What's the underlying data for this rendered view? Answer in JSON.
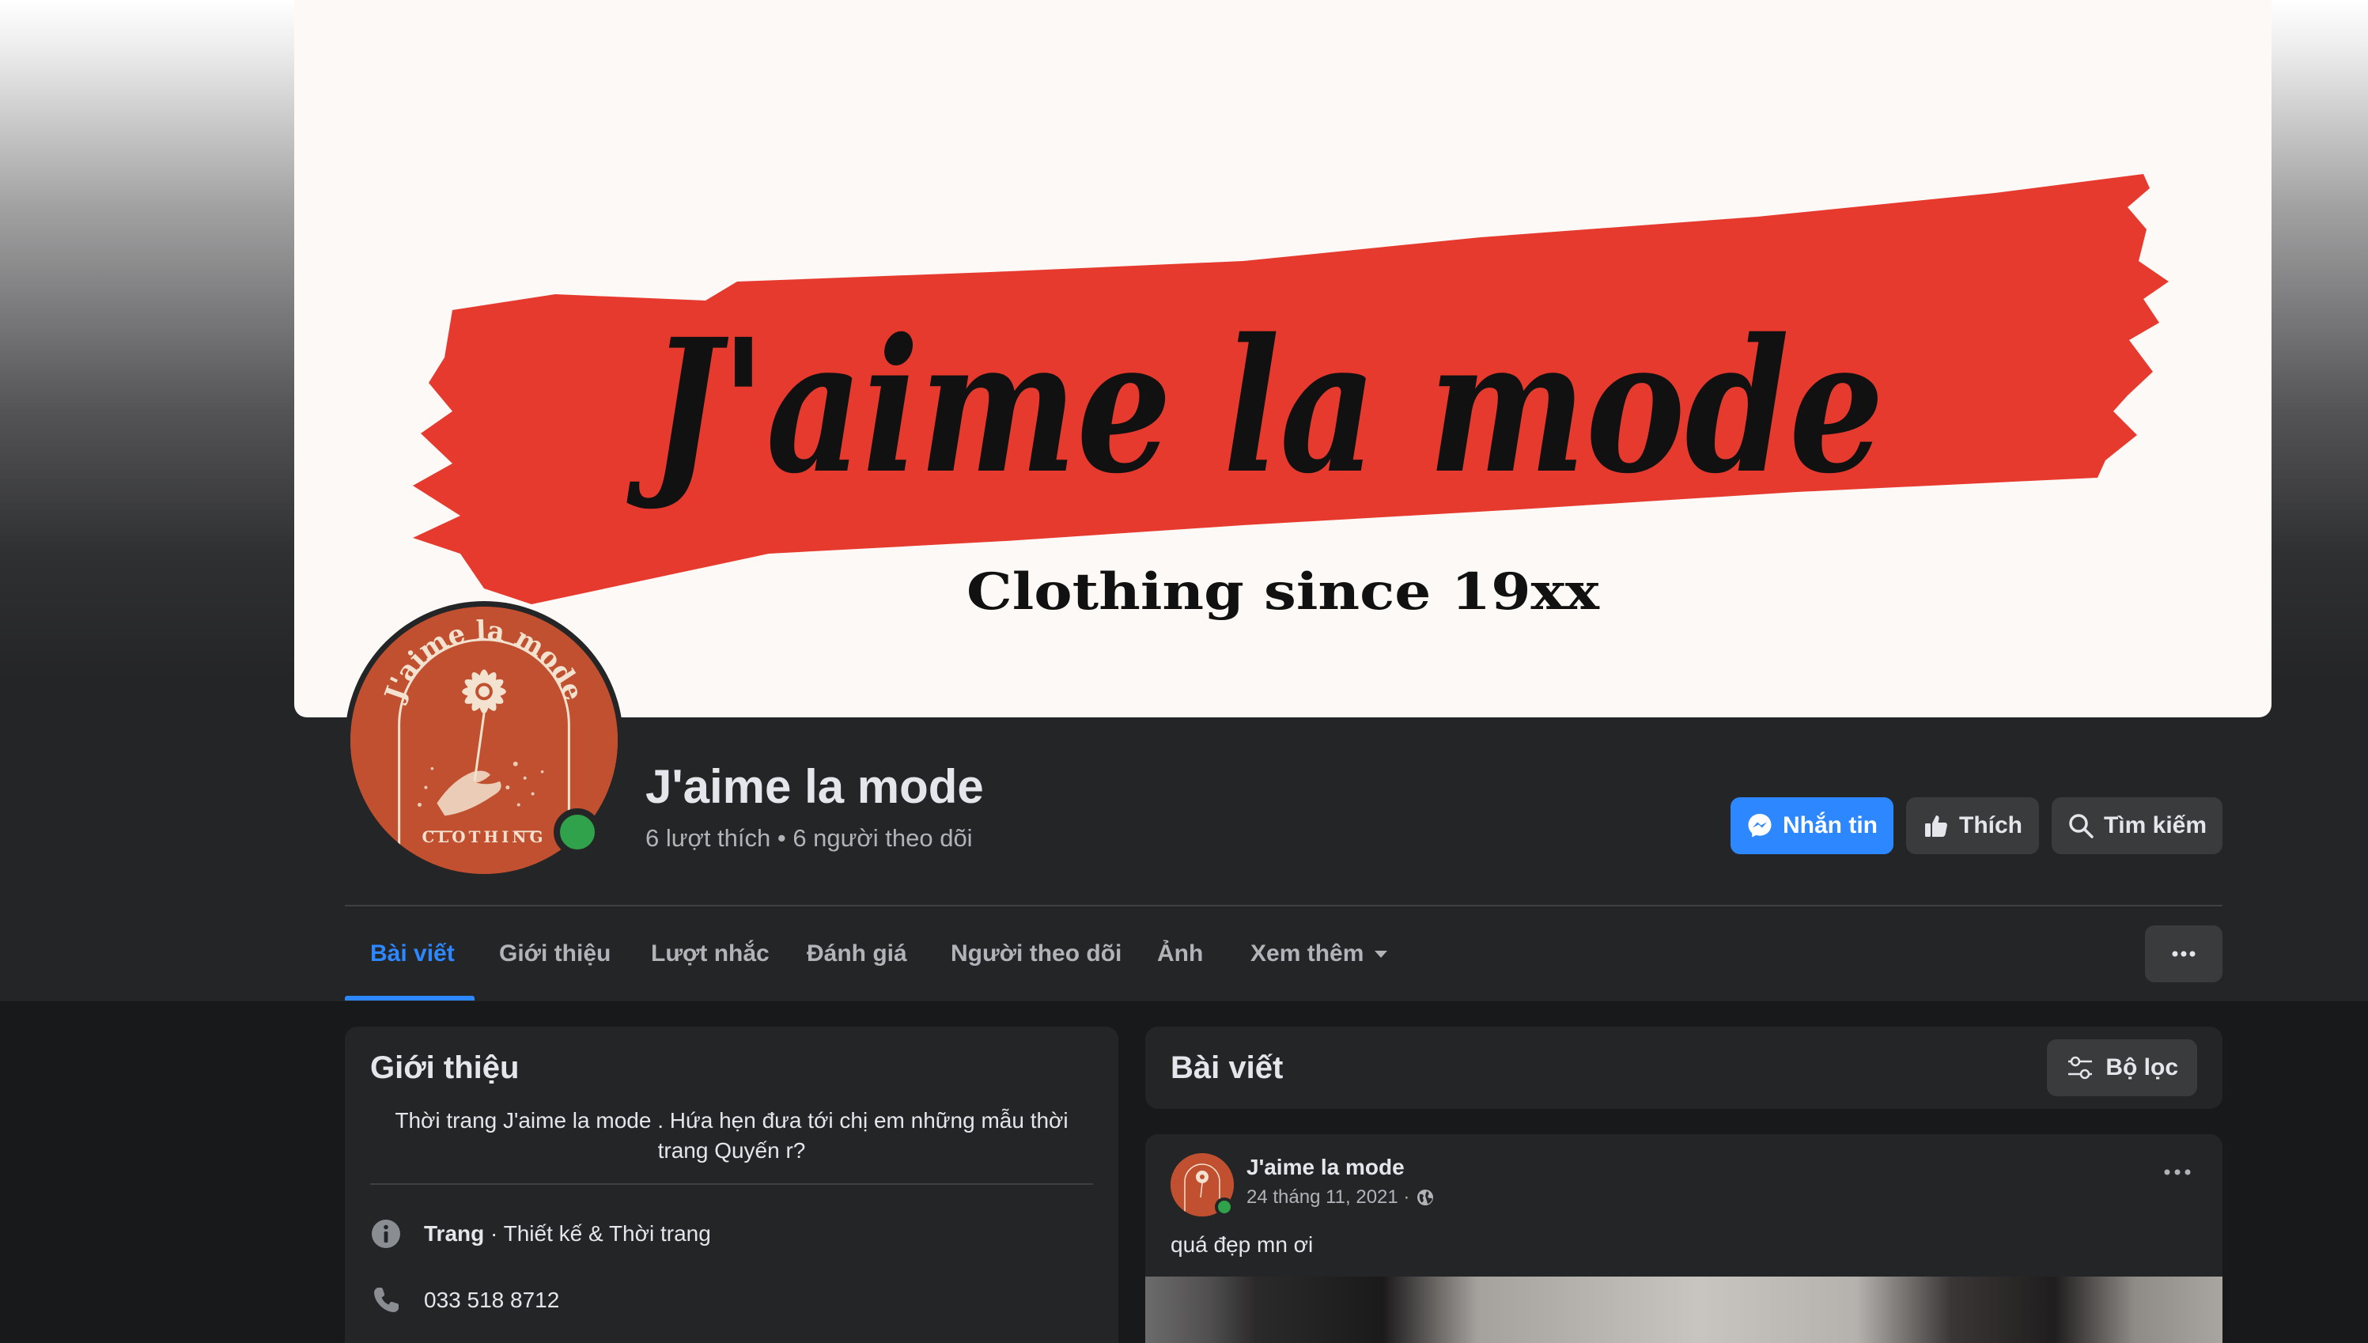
{
  "cover": {
    "brand_script": "J'aime la mode",
    "tagline": "Clothing since 19xx",
    "colors": {
      "background": "#fdf9f6",
      "brush": "#e63a2e",
      "ink": "#111111"
    }
  },
  "avatar": {
    "logo_text_top": "J'aime la mode",
    "logo_text_bottom": "CLOTHING",
    "color": "#c0502f"
  },
  "page": {
    "name": "J'aime la mode",
    "stats": "6 lượt thích • 6 người theo dõi"
  },
  "actions": {
    "message": "Nhắn tin",
    "like": "Thích",
    "search": "Tìm kiếm"
  },
  "tabs": [
    {
      "label": "Bài viết",
      "active": true
    },
    {
      "label": "Giới thiệu"
    },
    {
      "label": "Lượt nhắc"
    },
    {
      "label": "Đánh giá"
    },
    {
      "label": "Người theo dõi"
    },
    {
      "label": "Ảnh"
    },
    {
      "label": "Xem thêm"
    }
  ],
  "intro": {
    "title": "Giới thiệu",
    "bio": "Thời trang J'aime la mode . Hứa hẹn đưa tới chị em những mẫu thời trang Quyến r?",
    "category_label": "Trang",
    "category_value": " · Thiết kế & Thời trang",
    "phone": "033 518 8712"
  },
  "posts": {
    "title": "Bài viết",
    "filter_label": "Bộ lọc",
    "items": [
      {
        "author": "J'aime la mode",
        "date": "24 tháng 11, 2021 ·",
        "text": "quá đẹp mn ơi"
      }
    ]
  },
  "icons": {
    "message": "messenger-icon",
    "like": "thumbs-up-icon",
    "search": "search-icon",
    "more": "more-dots-icon",
    "dropdown": "caret-down-icon",
    "filter": "filter-sliders-icon",
    "info": "info-icon",
    "phone": "phone-icon",
    "privacy": "globe-icon"
  },
  "theme": {
    "accent": "#2d88ff",
    "online": "#31a24c",
    "surface": "#242526",
    "background": "#18191a"
  }
}
